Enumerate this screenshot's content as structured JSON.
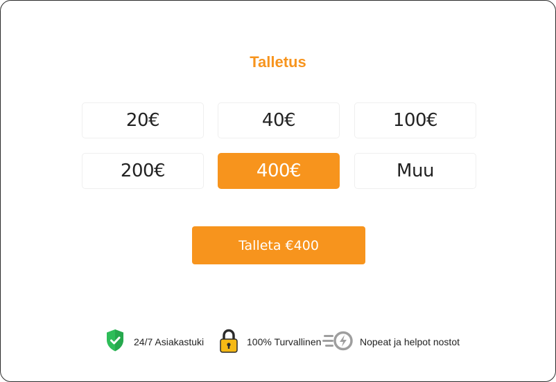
{
  "title": "Talletus",
  "amounts": [
    {
      "label": "20€",
      "selected": false
    },
    {
      "label": "40€",
      "selected": false
    },
    {
      "label": "100€",
      "selected": false
    },
    {
      "label": "200€",
      "selected": false
    },
    {
      "label": "400€",
      "selected": true
    },
    {
      "label": "Muu",
      "selected": false
    }
  ],
  "deposit_button": "Talleta €400",
  "features": [
    {
      "icon": "shield-check-icon",
      "label": "24/7 Asiakastuki"
    },
    {
      "icon": "padlock-icon",
      "label": "100% Turvallinen"
    },
    {
      "icon": "fast-payout-icon",
      "label": "Nopeat ja helpot nostot"
    }
  ],
  "colors": {
    "accent": "#f7941d",
    "shield": "#2ebd59",
    "lock": "#f5b915",
    "payout_icon": "#9e9e9e"
  }
}
